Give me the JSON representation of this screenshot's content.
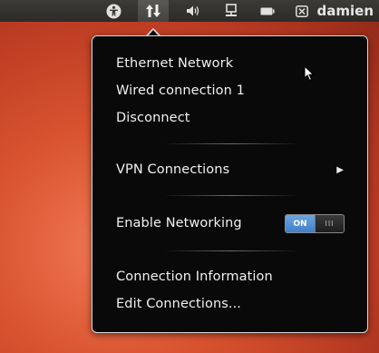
{
  "panel": {
    "username": "damien"
  },
  "network_menu": {
    "items": [
      {
        "label": "Ethernet Network"
      },
      {
        "label": "Wired connection 1"
      },
      {
        "label": "Disconnect"
      },
      {
        "label": "VPN Connections"
      },
      {
        "label": "Enable Networking"
      },
      {
        "label": "Connection Information"
      },
      {
        "label": "Edit Connections..."
      }
    ],
    "networking_toggle": {
      "state_label": "ON",
      "knob_label": "III",
      "enabled": true
    }
  },
  "colors": {
    "menu_background": "#090909",
    "toggle_on": "#4a8ad4",
    "panel": "#3c3b37"
  }
}
